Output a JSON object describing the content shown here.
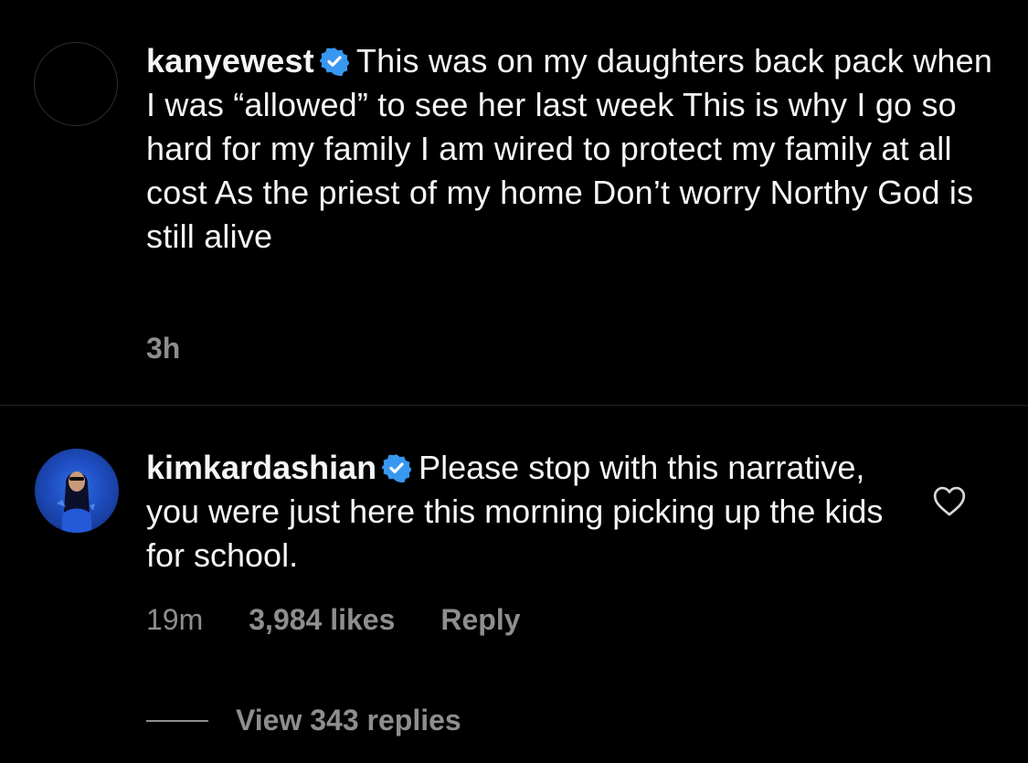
{
  "posts": [
    {
      "username": "kanyewest",
      "verified": true,
      "text": "This was on my daughters back pack when I was “allowed” to see her last week  This is why I go so hard for my family  I am wired to protect my family at all cost  As the priest of my home  Don’t worry Northy God is still alive",
      "time": "3h"
    },
    {
      "username": "kimkardashian",
      "verified": true,
      "text": "Please stop with this narrative, you were just here this morning picking up the kids for school.",
      "time": "19m",
      "likes": "3,984 likes",
      "reply_label": "Reply",
      "view_replies": "View 343 replies"
    }
  ],
  "colors": {
    "background": "#000000",
    "text": "#f5f5f5",
    "muted": "#8e8e8e",
    "verified": "#3897f0",
    "divider": "#262626"
  }
}
